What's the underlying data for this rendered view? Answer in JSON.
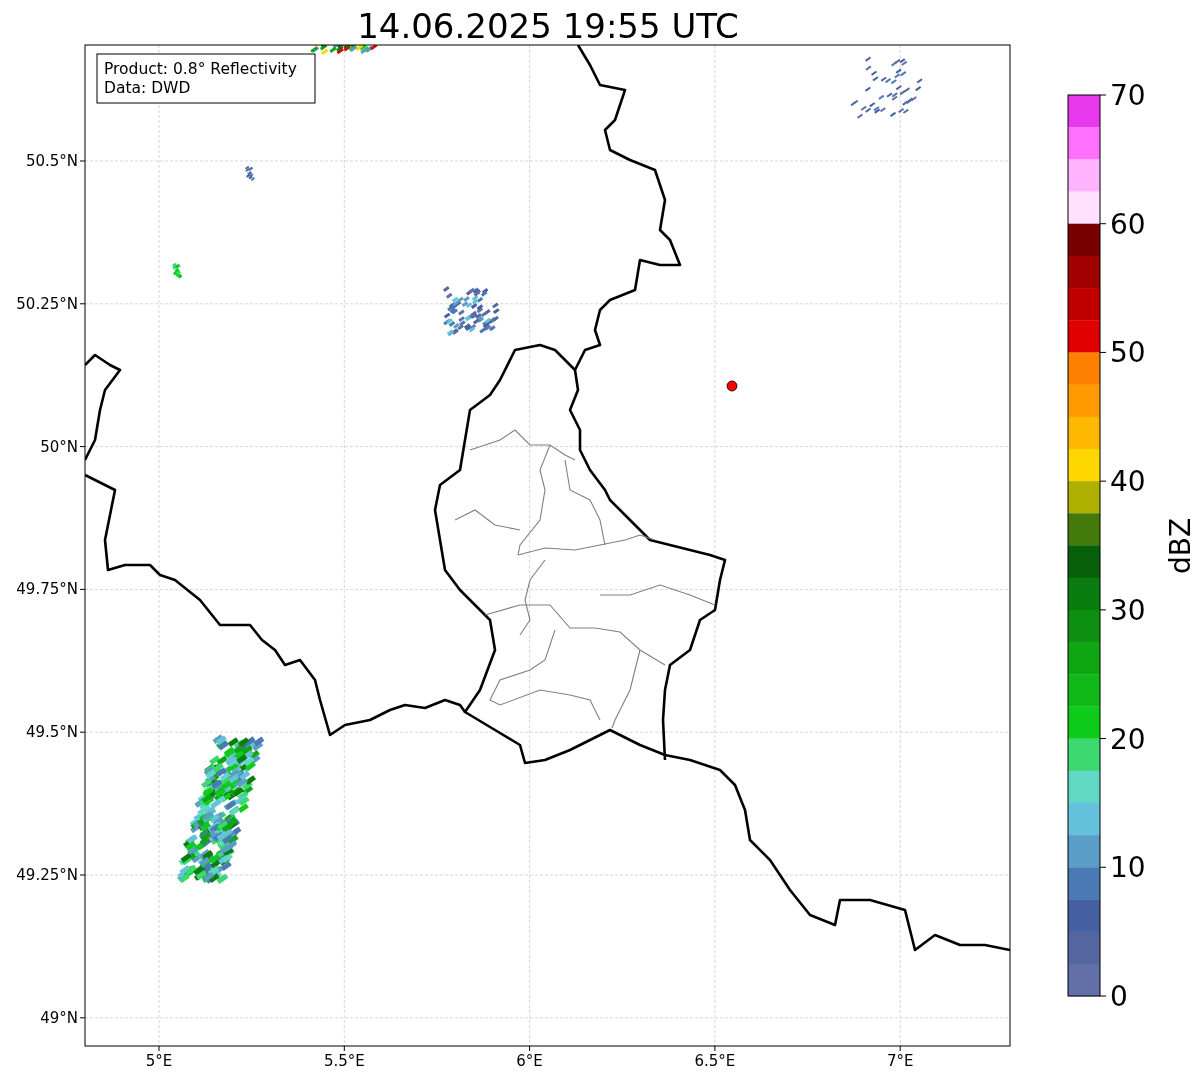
{
  "title": "14.06.2025 19:55 UTC",
  "info_box": {
    "lines": [
      "Product: 0.8° Reflectivity",
      "Data: DWD"
    ]
  },
  "map": {
    "x_ticks": [
      "5°E",
      "5.5°E",
      "6°E",
      "6.5°E",
      "7°E"
    ],
    "y_ticks": [
      "50.5°N",
      "50.25°N",
      "50°N",
      "49.75°N",
      "49.5°N",
      "49.25°N",
      "49°N"
    ]
  },
  "colorbar": {
    "label": "dBZ",
    "ticks": [
      "70",
      "60",
      "50",
      "40",
      "30",
      "20",
      "10",
      "0"
    ],
    "segments": [
      {
        "color": "#e838ec"
      },
      {
        "color": "#ff70ff"
      },
      {
        "color": "#ffb4ff"
      },
      {
        "color": "#ffe0ff"
      },
      {
        "color": "#780000"
      },
      {
        "color": "#a00000"
      },
      {
        "color": "#c00000"
      },
      {
        "color": "#e00000"
      },
      {
        "color": "#ff7f00"
      },
      {
        "color": "#ff9a00"
      },
      {
        "color": "#ffb800"
      },
      {
        "color": "#ffd700"
      },
      {
        "color": "#b0b000"
      },
      {
        "color": "#447a0c"
      },
      {
        "color": "#075f0a"
      },
      {
        "color": "#0b7c10"
      },
      {
        "color": "#0d9012"
      },
      {
        "color": "#0fa614"
      },
      {
        "color": "#10b818"
      },
      {
        "color": "#10cc1a"
      },
      {
        "color": "#3cd870"
      },
      {
        "color": "#60d8c4"
      },
      {
        "color": "#66c2dc"
      },
      {
        "color": "#5a9ec8"
      },
      {
        "color": "#4a7ab4"
      },
      {
        "color": "#4460a2"
      },
      {
        "color": "#5466a0"
      },
      {
        "color": "#6370a8"
      }
    ]
  }
}
